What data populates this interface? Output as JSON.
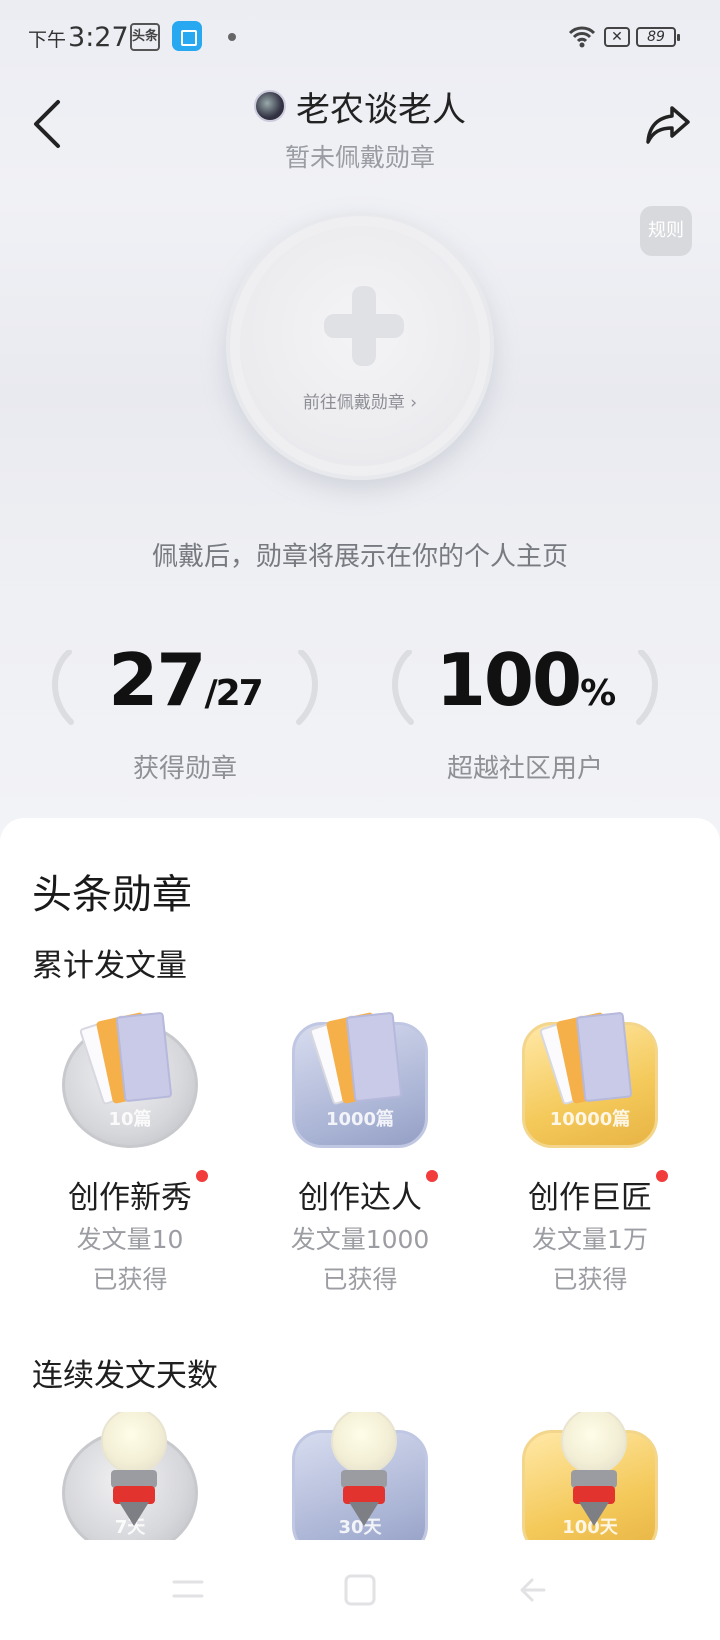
{
  "status_bar": {
    "time_prefix": "下午",
    "time": "3:27",
    "app_badge": "头条",
    "battery": "89",
    "icons": [
      "toutiao-app-icon",
      "store-app-icon",
      "notification-dot-icon",
      "wifi-icon",
      "sim-x-icon",
      "battery-icon"
    ]
  },
  "header": {
    "username": "老农谈老人",
    "subtitle": "暂未佩戴勋章",
    "back_icon": "chevron-left-icon",
    "share_icon": "share-icon",
    "rule_label": "规则"
  },
  "wear": {
    "link_label": "前往佩戴勋章 ›",
    "hint": "佩戴后，勋章将展示在你的个人主页"
  },
  "stats": {
    "earned_value": "27",
    "earned_total": "/27",
    "earned_label": "获得勋章",
    "percent_value": "100",
    "percent_suffix": "%",
    "percent_label": "超越社区用户"
  },
  "sheet": {
    "title": "头条勋章",
    "sections": [
      {
        "title": "累计发文量",
        "badges": [
          {
            "name": "创作新秀",
            "desc": "发文量10",
            "status": "已获得",
            "plate_label": "10篇",
            "tier": "silver"
          },
          {
            "name": "创作达人",
            "desc": "发文量1000",
            "status": "已获得",
            "plate_label": "1000篇",
            "tier": "blue"
          },
          {
            "name": "创作巨匠",
            "desc": "发文量1万",
            "status": "已获得",
            "plate_label": "10000篇",
            "tier": "gold"
          }
        ]
      },
      {
        "title": "连续发文天数",
        "badges": [
          {
            "plate_label": "7天",
            "tier": "silver"
          },
          {
            "plate_label": "30天",
            "tier": "blue"
          },
          {
            "plate_label": "100天",
            "tier": "gold"
          }
        ]
      }
    ]
  },
  "navbar": {
    "icons": [
      "recents-icon",
      "home-icon",
      "back-icon"
    ]
  },
  "colors": {
    "accent_red": "#f23c3c",
    "silver": "#d6d7db",
    "blue": "#a9b3d4",
    "gold": "#f4c95a"
  }
}
